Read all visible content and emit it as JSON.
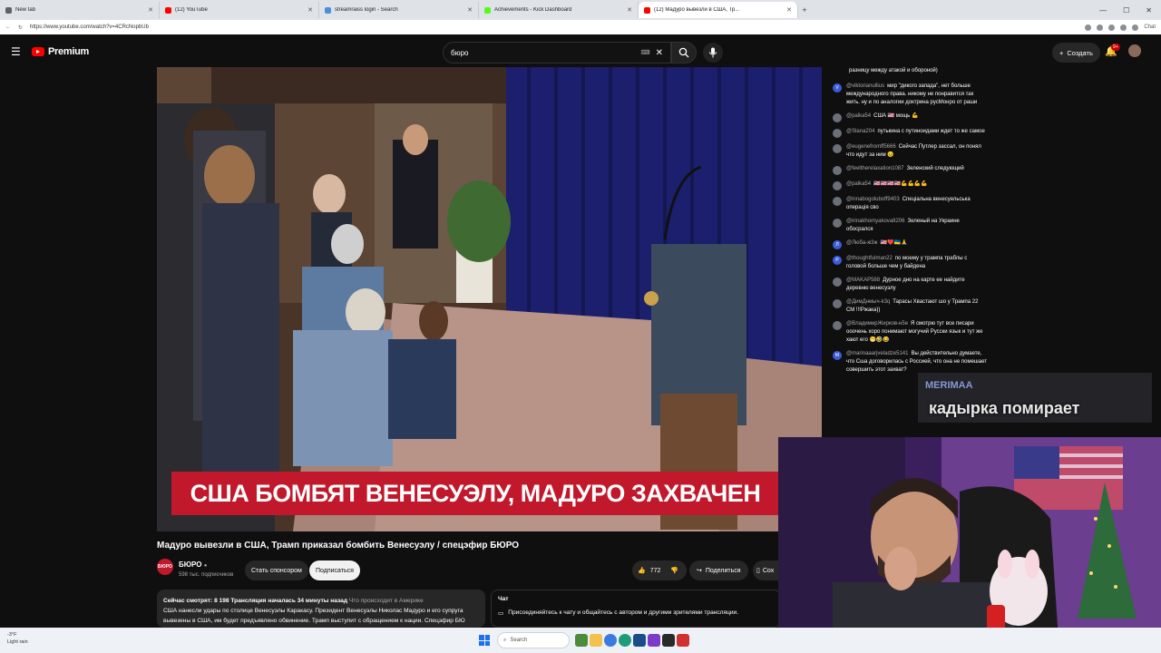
{
  "browser": {
    "tabs": [
      {
        "title": "New tab",
        "color": "#5f6368"
      },
      {
        "title": "(12) YouTube",
        "color": "#ff0000"
      },
      {
        "title": "streamraiss login - Search",
        "color": "#4a90d9"
      },
      {
        "title": "Achievements - Kick Dashboard",
        "color": "#53fc18"
      },
      {
        "title": "(12) Мадуро вывезли в США, Тр...",
        "color": "#ff0000"
      }
    ],
    "new_tab_symbol": "+",
    "url": "https://www.youtube.com/watch?v=4CRcNopbUb",
    "profile_label": "Chat"
  },
  "youtube": {
    "logo_text": "Premium",
    "search_value": "бюро",
    "create_label": "Создать",
    "notifications_badge": "9+"
  },
  "video": {
    "banner_text": "США БОМБЯТ ВЕНЕСУЭЛУ, МАДУРО ЗАХВАЧЕН",
    "title": "Мадуро вывезли в США, Трамп приказал бомбить Венесуэлу / спецэфир БЮРО",
    "channel_avatar_text": "БЮРО",
    "channel_name": "БЮРО",
    "channel_subs": "598 тыс. подписчиков",
    "sponsor_label": "Стать спонсором",
    "subscribe_label": "Подписаться",
    "likes": "772",
    "share_label": "Поделиться",
    "more_label": "Сох",
    "desc_meta": "Сейчас смотрят: 8 198  Трансляция началась 34 минуты назад",
    "desc_tag": "Что происходит в Америке",
    "desc_text": "США нанесли удары по столице Венесуэлы Каракасу. Президент Венесуэлы Николас Мадуро и его супруга вывезены в США, им будет предъявлено обвинение. Трамп выступит с обращением к нации. Спецэфир БЮ ...ещё"
  },
  "chat_panel": {
    "heading": "Чат",
    "invite": "Присоединяйтесь к чату и общайтесь с автором и другими зрителями трансляции."
  },
  "live_chat": [
    {
      "user": "",
      "text": "разницу между атакой и обороной)"
    },
    {
      "user": "@viktorianullius",
      "text": "мир \"дикого запада\", нет больше международного права. никому не понравится так жить. ну и по аналогии доктрина русМонро от раши",
      "avatar": "V"
    },
    {
      "user": "@palka54",
      "text": "США 🇺🇸 мощь 💪"
    },
    {
      "user": "@Slana204",
      "text": "путькина с путиноидами ждет то же самое"
    },
    {
      "user": "@eugenefromff5666",
      "text": "Сейчас Путлер зассал, он понял что идут за ним 😣"
    },
    {
      "user": "@feeltherelaxation1087",
      "text": "Зеленский следующий"
    },
    {
      "user": "@palka54",
      "text": "🇺🇸🇺🇸🇺🇸🇺🇸💪💪💪💪"
    },
    {
      "user": "@innabogoluboff9403",
      "text": "Спецiальна венесуельська операцiя сво"
    },
    {
      "user": "@irinakhomyakova8206",
      "text": "Зеленый на Украине обосрался"
    },
    {
      "user": "@Люба-ж3ж",
      "text": "🇺🇸❤️🇺🇦🙏",
      "avatar": "Л"
    },
    {
      "user": "@thoughtfulman22",
      "text": "по моему у трампа траблы с головой больше чем у байдена",
      "avatar": "P"
    },
    {
      "user": "@MAKAP588",
      "text": "Дурное дно на карте ее найдите деревню венесуэлу"
    },
    {
      "user": "@ДимДнмыч-k3q",
      "text": "Тарасы Хвастают шо у Трампа 22 СМ !!!Ржака))"
    },
    {
      "user": "@ВладимирЖирков-н5е",
      "text": "Я смотрю тут все писари ооочень хоро понимают могучий Русски язык и тут же хают его 😁🤣😂"
    },
    {
      "user": "@marinaaarjveladze5141",
      "text": "Вы действительно думаете, что Сша договорилась с Россией, что она не помешает совершить этот захват?",
      "avatar": "M"
    }
  ],
  "stream_overlay": {
    "name": "MERIMAA",
    "message": "кадырка помирает"
  },
  "taskbar": {
    "temp": "-3°F",
    "weather": "Light rain",
    "search_placeholder": "Search"
  }
}
